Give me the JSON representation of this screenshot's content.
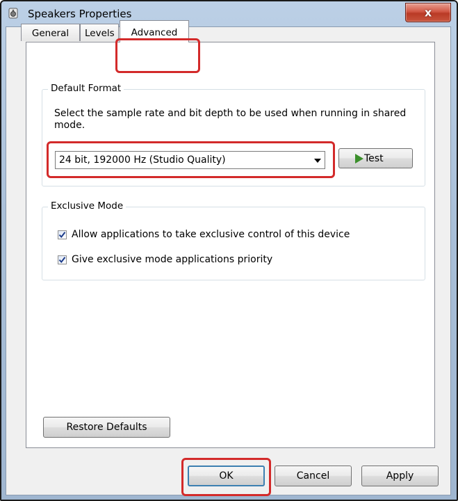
{
  "window": {
    "title": "Speakers Properties",
    "close_label": "x"
  },
  "tabs": [
    {
      "label": "General",
      "selected": false
    },
    {
      "label": "Levels",
      "selected": false
    },
    {
      "label": "Advanced",
      "selected": true
    }
  ],
  "default_format": {
    "legend": "Default Format",
    "description": "Select the sample rate and bit depth to be used when running in shared mode.",
    "selected_format": "24 bit, 192000 Hz (Studio Quality)",
    "test_label": "Test"
  },
  "exclusive_mode": {
    "legend": "Exclusive Mode",
    "options": [
      {
        "label": "Allow applications to take exclusive control of this device",
        "checked": true
      },
      {
        "label": "Give exclusive mode applications priority",
        "checked": true
      }
    ]
  },
  "buttons": {
    "restore_defaults": "Restore Defaults",
    "ok": "OK",
    "cancel": "Cancel",
    "apply": "Apply"
  },
  "colors": {
    "highlight": "#d32a2a",
    "test_play": "#3b8f2b"
  }
}
